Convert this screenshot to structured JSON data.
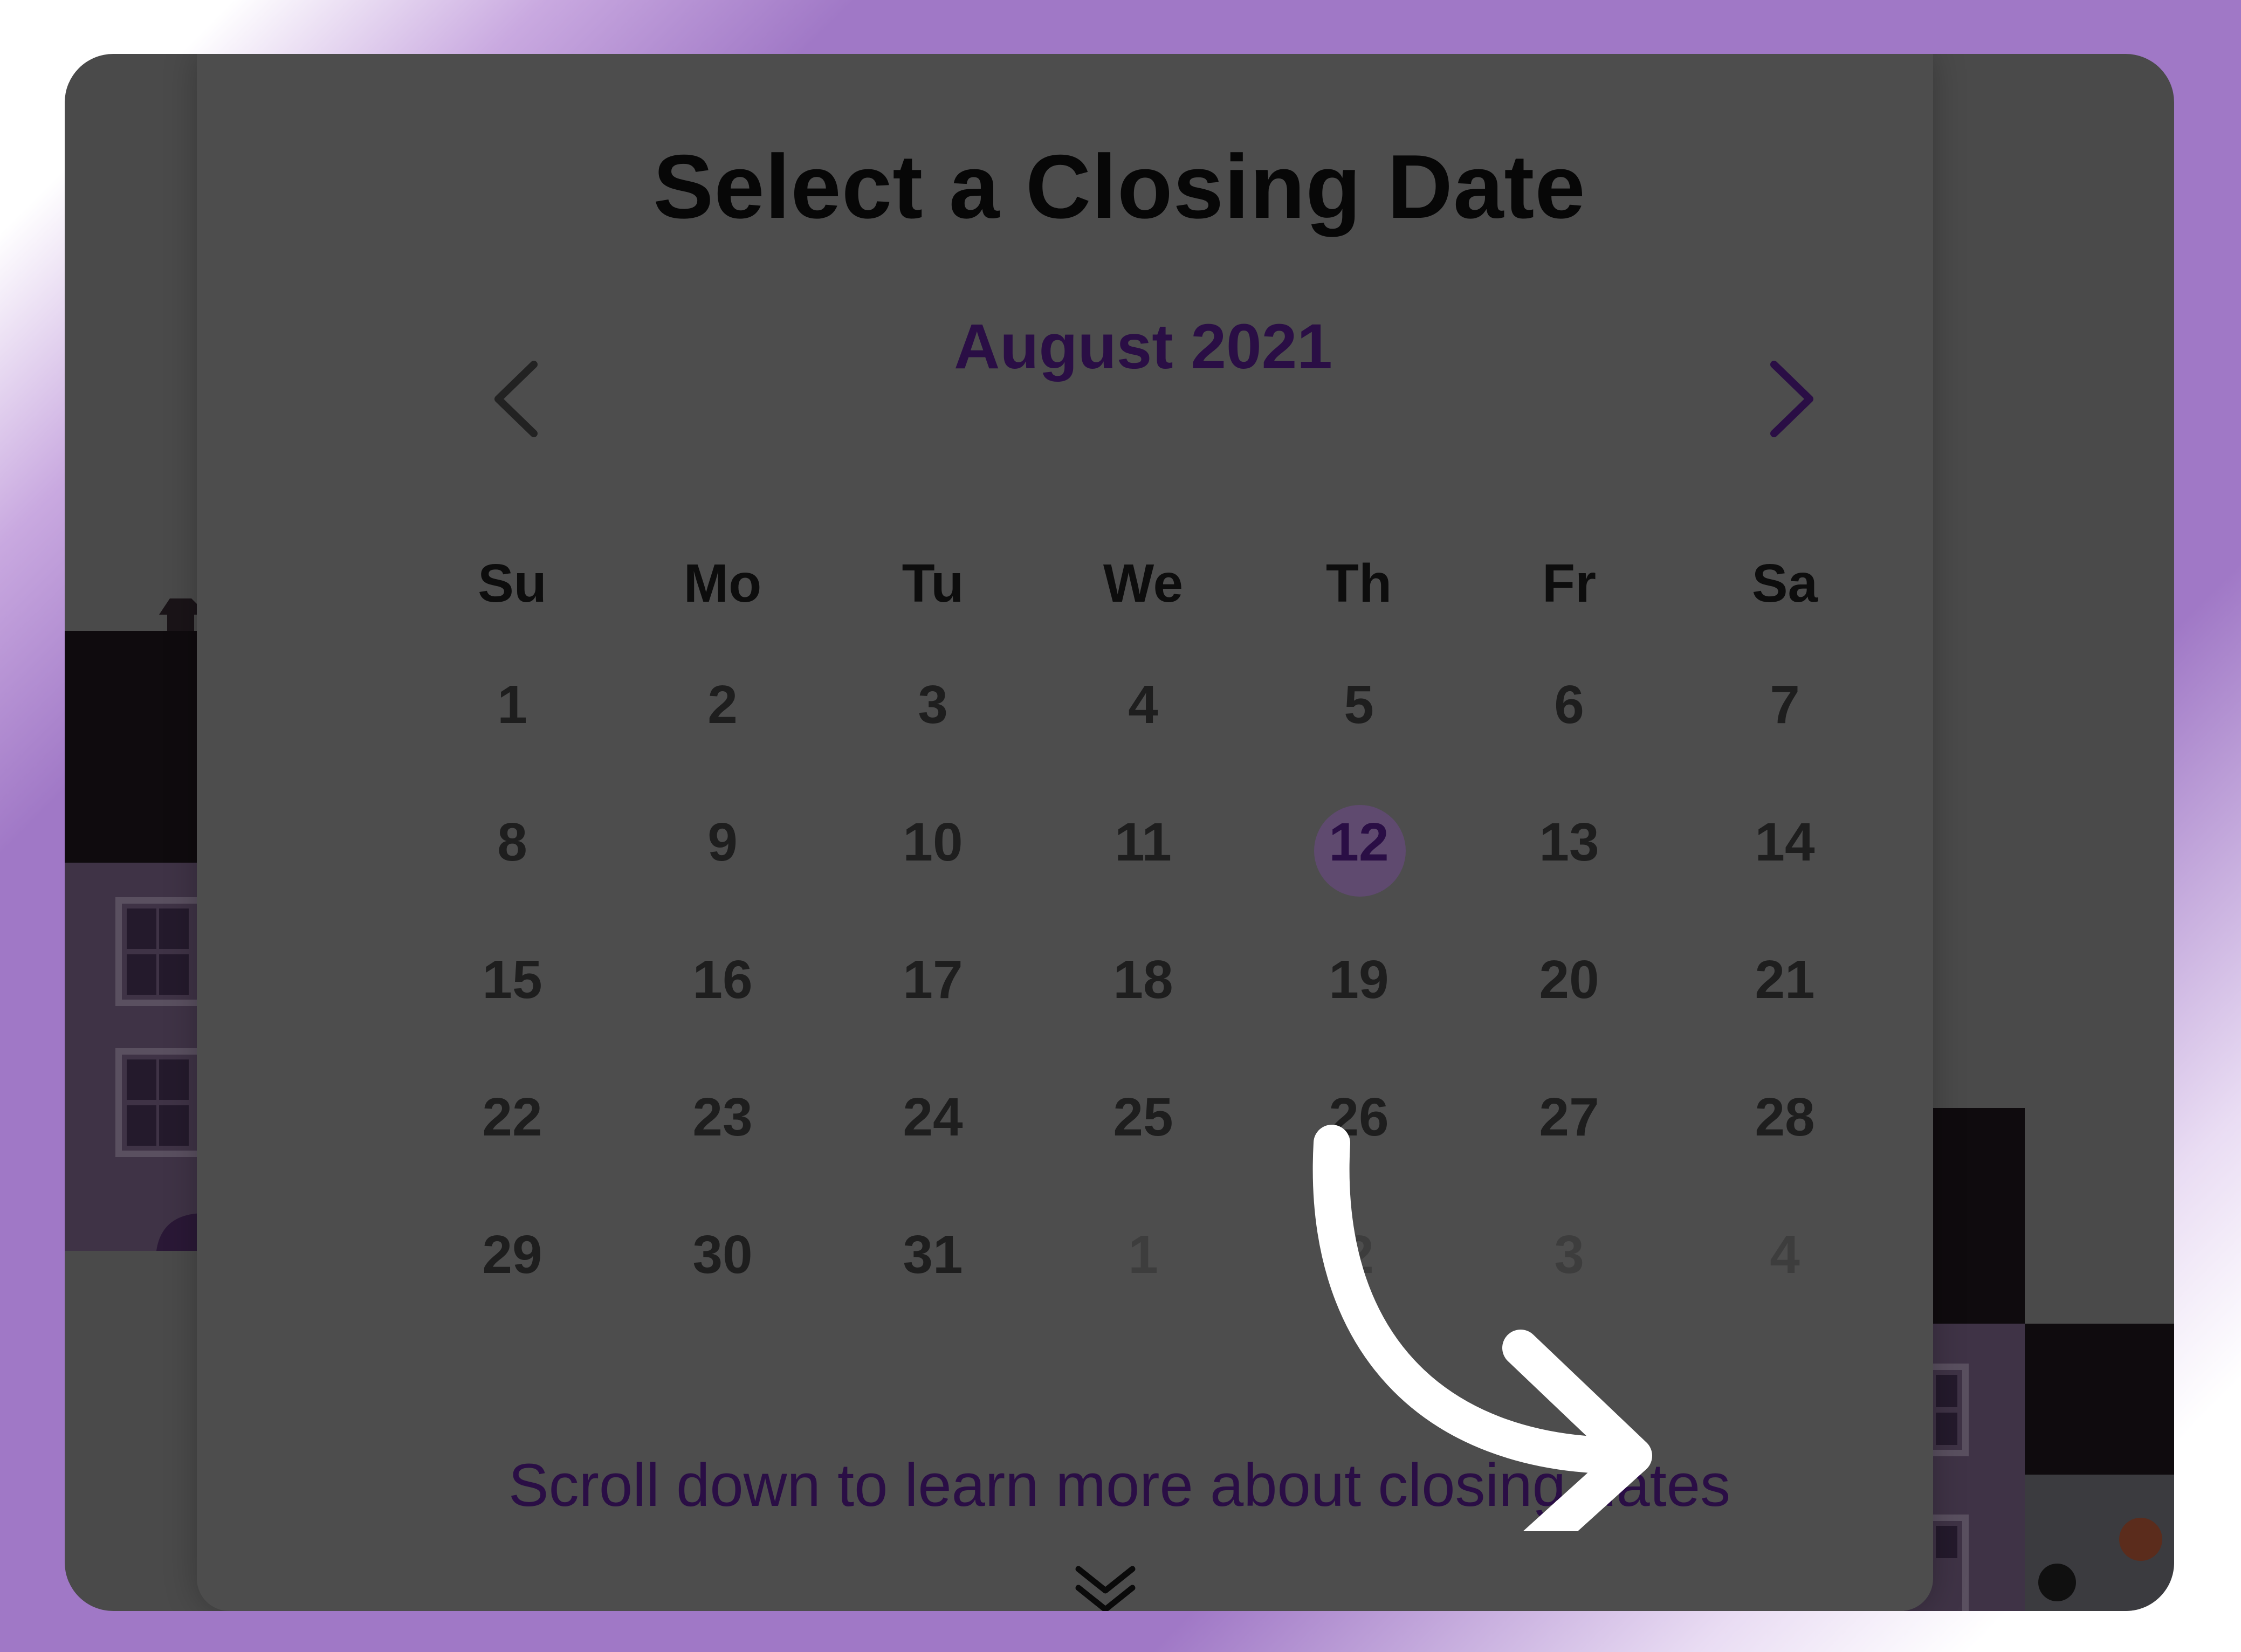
{
  "title": "Select a Closing Date",
  "calendar": {
    "month_label": "August 2021",
    "prev_icon": "chevron-left-icon",
    "next_icon": "chevron-right-icon",
    "weekdays": [
      "Su",
      "Mo",
      "Tu",
      "We",
      "Th",
      "Fr",
      "Sa"
    ],
    "weeks": [
      [
        "1",
        "2",
        "3",
        "4",
        "5",
        "6",
        "7"
      ],
      [
        "8",
        "9",
        "10",
        "11",
        "12",
        "13",
        "14"
      ],
      [
        "15",
        "16",
        "17",
        "18",
        "19",
        "20",
        "21"
      ],
      [
        "22",
        "23",
        "24",
        "25",
        "26",
        "27",
        "28"
      ],
      [
        "29",
        "30",
        "31",
        "1",
        "2",
        "3",
        "4"
      ]
    ],
    "selected_day": "12",
    "accent_color": "#2a0e45"
  },
  "footer": {
    "hint": "Scroll down to learn more about closing dates",
    "scroll_icon": "double-chevron-down-icon"
  },
  "overlay": {
    "annotation_icon": "curved-arrow-icon"
  }
}
